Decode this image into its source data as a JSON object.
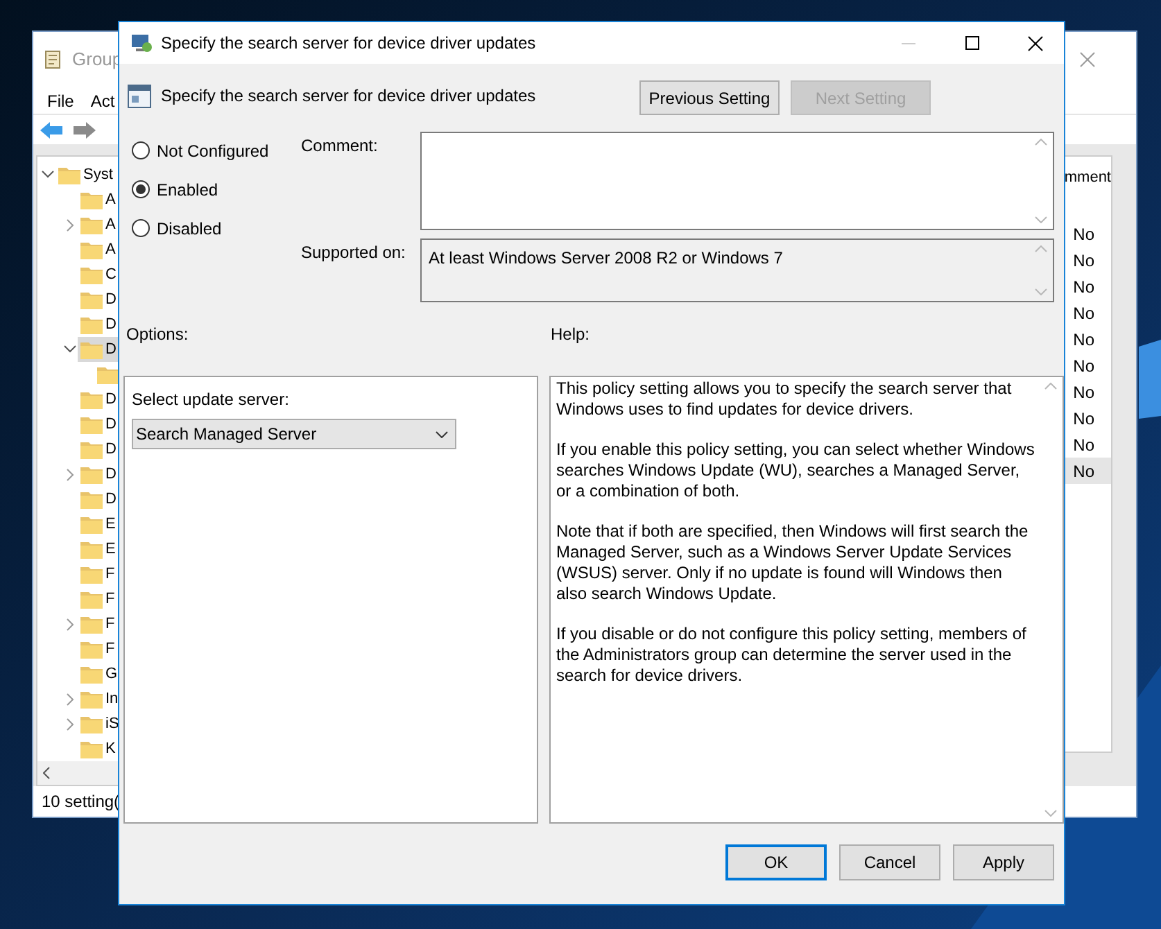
{
  "background_window": {
    "title": "Group",
    "menu": [
      "File",
      "Act"
    ],
    "tree": [
      {
        "label": "Syst",
        "selected": false,
        "expanded": true,
        "children": [
          {
            "label": "A",
            "selected": false
          },
          {
            "label": "A",
            "selected": false,
            "expanded": false
          },
          {
            "label": "A",
            "selected": false
          },
          {
            "label": "C",
            "selected": false
          },
          {
            "label": "D",
            "selected": false
          },
          {
            "label": "D",
            "selected": false
          },
          {
            "label": "D",
            "selected": true,
            "expanded": true,
            "children": [
              {
                "selected": false
              }
            ]
          },
          {
            "label": "D",
            "selected": false
          },
          {
            "label": "D",
            "selected": false
          },
          {
            "label": "D",
            "selected": false
          },
          {
            "label": "D",
            "selected": false,
            "expanded": false
          },
          {
            "label": "D",
            "selected": false
          },
          {
            "label": "E",
            "selected": false
          },
          {
            "label": "E",
            "selected": false
          },
          {
            "label": "F",
            "selected": false
          },
          {
            "label": "F",
            "selected": false
          },
          {
            "label": "F",
            "selected": false,
            "expanded": false
          },
          {
            "label": "F",
            "selected": false
          },
          {
            "label": "G",
            "selected": false
          },
          {
            "label": "In",
            "selected": false,
            "expanded": false
          },
          {
            "label": "iS",
            "selected": false,
            "expanded": false
          },
          {
            "label": "K",
            "selected": false
          }
        ]
      }
    ],
    "column_header": "mment",
    "rows": [
      {
        "value": "No",
        "selected": false
      },
      {
        "value": "No",
        "selected": false
      },
      {
        "value": "No",
        "selected": false
      },
      {
        "value": "No",
        "selected": false
      },
      {
        "value": "No",
        "selected": false
      },
      {
        "value": "No",
        "selected": false
      },
      {
        "value": "No",
        "selected": false
      },
      {
        "value": "No",
        "selected": false
      },
      {
        "value": "No",
        "selected": false
      },
      {
        "value": "No",
        "selected": true
      }
    ],
    "status": "10 setting("
  },
  "dialog": {
    "title": "Specify the search server for device driver updates",
    "heading": "Specify the search server for device driver updates",
    "nav_buttons": [
      {
        "label": "Previous Setting",
        "disabled": false
      },
      {
        "label": "Next Setting",
        "disabled": true
      }
    ],
    "radios": [
      {
        "label": "Not Configured",
        "selected": false
      },
      {
        "label": "Enabled",
        "selected": true
      },
      {
        "label": "Disabled",
        "selected": false
      }
    ],
    "comment": {
      "label": "Comment:"
    },
    "supported_on": {
      "label": "Supported on:",
      "value": "At least Windows Server 2008 R2 or Windows 7"
    },
    "options": {
      "label": "Options:",
      "select_label": "Select update server:",
      "select_value": "Search Managed Server"
    },
    "help": {
      "label": "Help:",
      "paragraphs": [
        "This policy setting allows you to specify the search server that Windows uses to find updates for device drivers.",
        "If you enable this policy setting, you can select whether Windows searches Windows Update (WU), searches a Managed Server, or a combination of both.",
        "Note that if both are specified, then Windows will first search the Managed Server, such as a Windows Server Update Services (WSUS) server. Only if no update is found will Windows then also search Windows Update.",
        "If you disable or do not configure this policy setting, members of the Administrators group can determine the server used in the search for device drivers."
      ]
    },
    "buttons": [
      {
        "label": "OK",
        "default": true
      },
      {
        "label": "Cancel",
        "default": false
      },
      {
        "label": "Apply",
        "default": false
      }
    ]
  }
}
